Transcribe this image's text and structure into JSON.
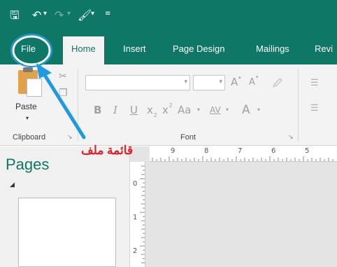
{
  "qat": {
    "save_icon": "save-icon",
    "undo_icon": "undo-icon",
    "redo_icon": "redo-icon",
    "format_painter_icon": "format-painter-icon",
    "customize_icon": "customize-qat-icon"
  },
  "tabs": [
    {
      "label": "File"
    },
    {
      "label": "Home"
    },
    {
      "label": "Insert"
    },
    {
      "label": "Page Design"
    },
    {
      "label": "Mailings"
    },
    {
      "label": "Revi"
    }
  ],
  "ribbon": {
    "clipboard": {
      "paste_label": "Paste",
      "group_label": "Clipboard"
    },
    "font": {
      "group_label": "Font",
      "grow_label": "A",
      "shrink_label": "A",
      "bold_label": "B",
      "italic_label": "I",
      "underline_label": "U",
      "subscript_label": "x",
      "superscript_label": "x",
      "case_label": "Aa",
      "spacing_label": "AV",
      "color_label": "A"
    }
  },
  "pages_panel": {
    "title": "Pages"
  },
  "ruler": {
    "horizontal_numbers": [
      "9",
      "8",
      "7",
      "6",
      "5"
    ],
    "vertical_numbers": [
      "0",
      "1",
      "2"
    ]
  },
  "annotation": {
    "text": "قائمة ملف",
    "color": "#e0202a",
    "arrow_color": "#1e9be0"
  },
  "colors": {
    "accent": "#0f7765",
    "ribbon": "#f3f3f3"
  }
}
